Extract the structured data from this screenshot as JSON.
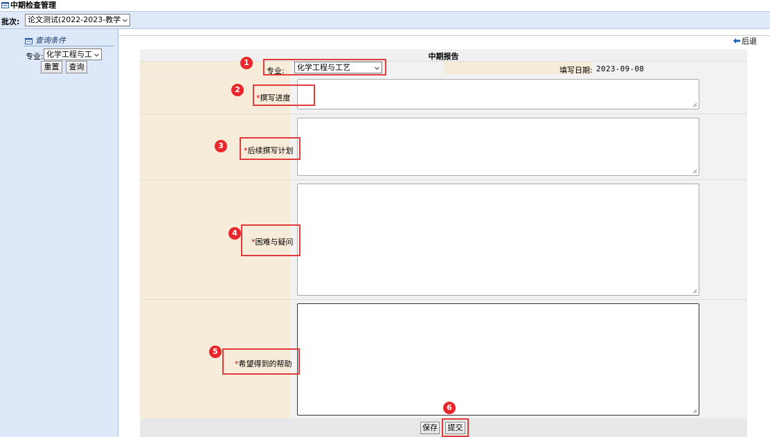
{
  "title_bar": {
    "title": "中期检查管理",
    "icon": "window-icon"
  },
  "batch_bar": {
    "label": "批次:",
    "selected": "论文测试(2022-2023-教学实"
  },
  "left_panel": {
    "header": "查询条件",
    "major_label": "专业:",
    "major_selected": "化学工程与工艺",
    "reset_label": "重置",
    "query_label": "查询"
  },
  "back_label": "后退",
  "form": {
    "title": "中期报告",
    "major_label": "专业:",
    "major_selected": "化学工程与工艺",
    "date_label": "填写日期:",
    "date_value": "2023-09-08",
    "fields": [
      {
        "required": "*",
        "label": "撰写进度",
        "value": ""
      },
      {
        "required": "*",
        "label": "后续撰写计划",
        "value": ""
      },
      {
        "required": "*",
        "label": "困难与疑问",
        "value": ""
      },
      {
        "required": "*",
        "label": "希望得到的帮助",
        "value": ""
      }
    ],
    "save_label": "保存",
    "submit_label": "提交"
  },
  "annotations": [
    "1",
    "2",
    "3",
    "4",
    "5",
    "6"
  ],
  "colors": {
    "annotation_red": "#e03a3a",
    "badge_red": "#e8262b",
    "required_red": "#d00000",
    "panel_blue": "#dde8f8",
    "label_beige": "#f7ecd9"
  }
}
